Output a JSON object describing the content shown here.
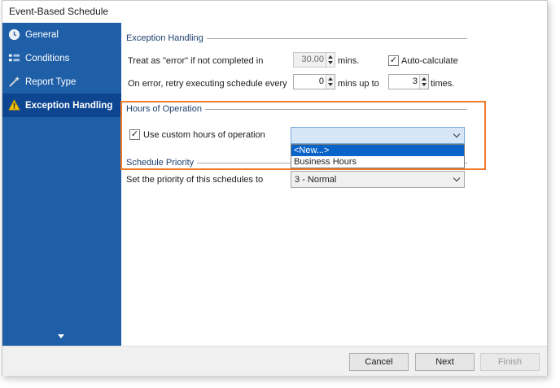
{
  "window": {
    "title": "Event-Based Schedule"
  },
  "sidebar": {
    "items": [
      {
        "label": "General",
        "icon": "clock-icon"
      },
      {
        "label": "Conditions",
        "icon": "conditions-icon"
      },
      {
        "label": "Report Type",
        "icon": "wand-icon"
      },
      {
        "label": "Exception Handling",
        "icon": "warning-icon",
        "active": true
      }
    ]
  },
  "exception_handling": {
    "header": "Exception Handling",
    "treat_error_label": "Treat as \"error\" if not completed in",
    "treat_error_value": "30.00",
    "treat_error_unit": "mins.",
    "auto_calculate_label": "Auto-calculate",
    "auto_calculate_checked": true,
    "retry_label": "On error, retry  executing schedule every",
    "retry_value": "0",
    "retry_unit": "mins up to",
    "times_value": "3",
    "times_unit": "times."
  },
  "hours_of_operation": {
    "header": "Hours of Operation",
    "use_custom_label": "Use custom hours of operation",
    "use_custom_checked": true,
    "selected_value": "",
    "options": [
      "<New...>",
      "Business Hours"
    ],
    "highlighted_option": "<New...>"
  },
  "schedule_priority": {
    "header": "Schedule Priority",
    "label": "Set the priority of this schedules to",
    "value": "3 - Normal"
  },
  "footer": {
    "cancel": "Cancel",
    "next": "Next",
    "finish": "Finish"
  },
  "colors": {
    "sidebar": "#1f5fa8",
    "sidebar_active": "#0d4590",
    "highlight": "#ef7b2a",
    "selection": "#0a64c8"
  }
}
